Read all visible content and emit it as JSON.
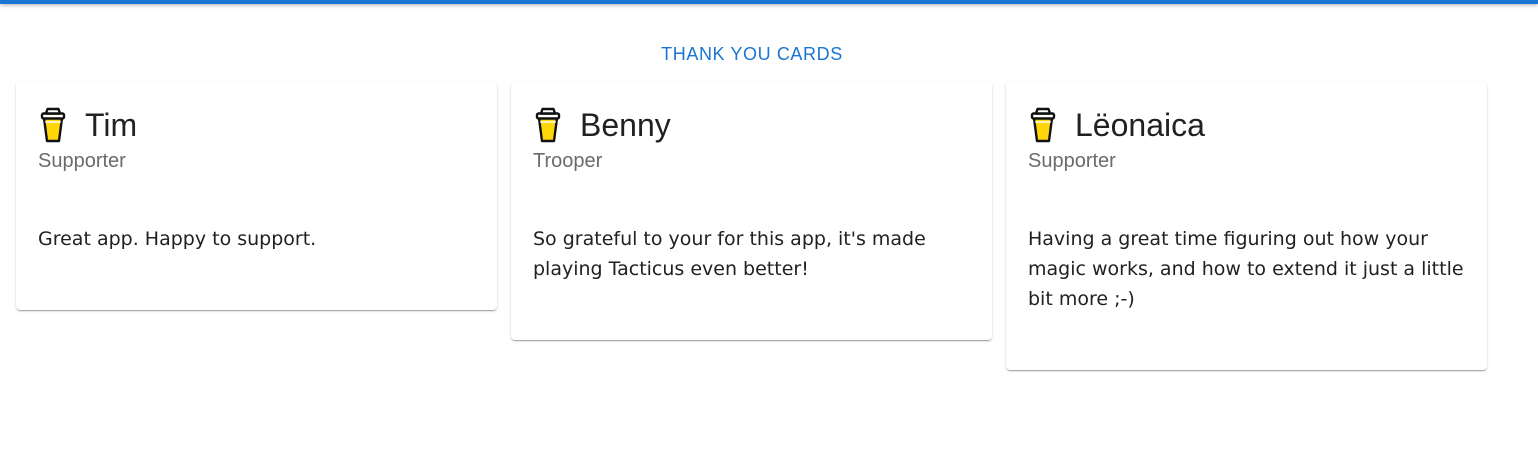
{
  "header": {
    "title": "THANK YOU CARDS"
  },
  "cards": [
    {
      "icon": "coffee-cup-icon",
      "name": "Tim",
      "role": "Supporter",
      "message": "Great app. Happy to support."
    },
    {
      "icon": "coffee-cup-icon",
      "name": "Benny",
      "role": "Trooper",
      "message": "So grateful to your for this app, it's made playing Tacticus even better!"
    },
    {
      "icon": "coffee-cup-icon",
      "name": "Lëonaica",
      "role": "Supporter",
      "message": "Having a great time figuring out how your magic works, and how to extend it just a little bit more ;-)"
    }
  ],
  "colors": {
    "accent": "#1976d2",
    "cup_fill": "#ffd60a"
  }
}
